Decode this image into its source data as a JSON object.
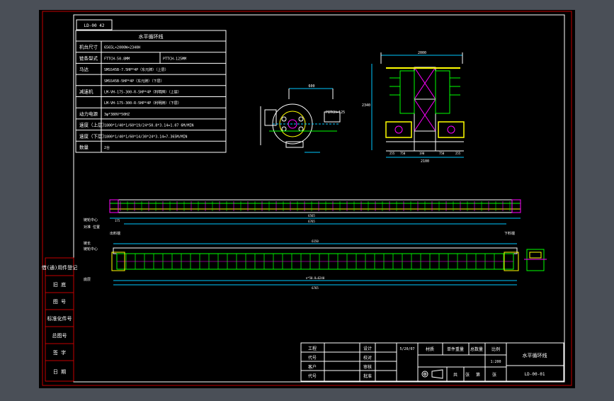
{
  "colors": {
    "canvas": "#000000",
    "frame": "#c40000",
    "line": "#ffffff",
    "accent_green": "#00ff00",
    "accent_yellow": "#ffff00",
    "accent_magenta": "#ff00ff",
    "accent_cyan": "#00c8ff"
  },
  "drawing_no_top": "LD-00 42",
  "spec_table": {
    "title": "水平循环线",
    "rows": [
      {
        "label": "机台尺寸",
        "value": "6565L×2000W×2340H"
      },
      {
        "label": "链条型式",
        "value": "FTTCH-50.8MM",
        "value2": "PTTCH-125MM"
      },
      {
        "label": "马达",
        "value": "SMSS45B-7.5HP*4P（东元牌）（上层）"
      },
      {
        "label": "",
        "value": "SMSS45B-5HP*4P（东元牌）（下层）"
      },
      {
        "label": "减速机",
        "value": "LM-VH-175-300-R-5HP*4P（利明牌）（上层）"
      },
      {
        "label": "",
        "value": "LM-VH-175-300-R-5HP*4P（利明牌）（下层）"
      },
      {
        "label": "动力电源",
        "value": "3φ*380V*50HZ"
      },
      {
        "label": "速度（上层）",
        "value": "1800*1/40*1/60*19/24*50.8*3.14=1.07 6M/MIN"
      },
      {
        "label": "速度（下层）",
        "value": "1800*1/40*1/60*14/30*24*3.14=7.365M/MIN"
      },
      {
        "label": "数量",
        "value": "2台"
      }
    ]
  },
  "left_column": [
    "借(通)用件登记",
    "旧 底",
    "图 号",
    "标准化件号",
    "总图号",
    "签 字",
    "日 期"
  ],
  "dims": {
    "top_width": "2000",
    "side_height": "2340",
    "bottom_width": "2100",
    "front_small": "600",
    "pitch": "PITCH=125",
    "sub_dims": [
      "255",
      "750",
      "190",
      "750",
      "255"
    ],
    "long_total": "6565",
    "long_overall": "6765",
    "bottom_total": "6150",
    "left_end": "175",
    "pitch_formula": "n*50.8=6240"
  },
  "labels": {
    "upper_a": "链轮中心",
    "upper_b": "对准 位置",
    "upper_c": "出料端",
    "upper_d": "下料端",
    "lower_a": "链长",
    "lower_b": "链轮中心",
    "lower_c": "底层"
  },
  "title_block": {
    "left_rows": [
      "工程",
      "代号",
      "客户",
      "代号"
    ],
    "mid_rows": [
      "设计",
      "校对",
      "审核",
      "批准"
    ],
    "date": "5/20/07",
    "header_cells": [
      "材质",
      "单件重量",
      "总数量",
      "比例"
    ],
    "scale": "1:200",
    "bottom_cells": [
      "共",
      "张",
      "第",
      "张"
    ],
    "name": "水平循环线",
    "drawing_no": "LD-00-01"
  }
}
